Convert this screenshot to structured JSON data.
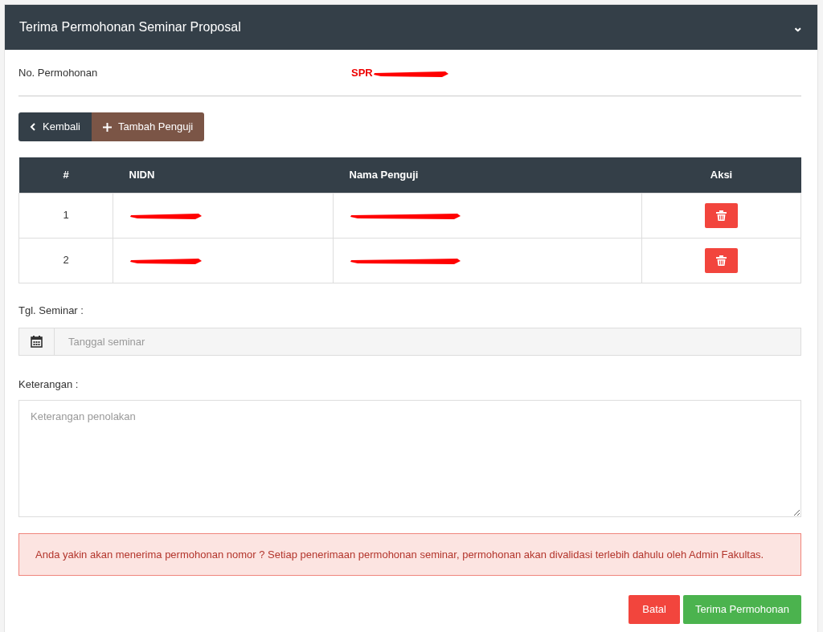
{
  "card": {
    "title": "Terima Permohonan Seminar Proposal",
    "collapse_icon": "⌄"
  },
  "request": {
    "label": "No. Permohonan",
    "value": "SPR",
    "redacted": true
  },
  "toolbar": {
    "back": "Kembali",
    "add": "Tambah Penguji"
  },
  "table": {
    "columns": [
      "#",
      "NIDN",
      "Nama Penguji",
      "Aksi"
    ],
    "rows": [
      {
        "number": "1",
        "nidn_redacted": true,
        "name_redacted": true
      },
      {
        "number": "2",
        "nidn_redacted": true,
        "name_redacted": true
      }
    ]
  },
  "seminar_date": {
    "label": "Tgl. Seminar :",
    "placeholder": "Tanggal seminar"
  },
  "notes": {
    "label": "Keterangan :",
    "placeholder": "Keterangan penolakan"
  },
  "alert": "Anda yakin akan menerima permohonan nomor ? Setiap penerimaan permohonan seminar, permohonan akan divalidasi terlebih dahulu oleh Admin Fakultas.",
  "buttons": {
    "cancel": "Batal",
    "accept": "Terima Permohonan"
  }
}
